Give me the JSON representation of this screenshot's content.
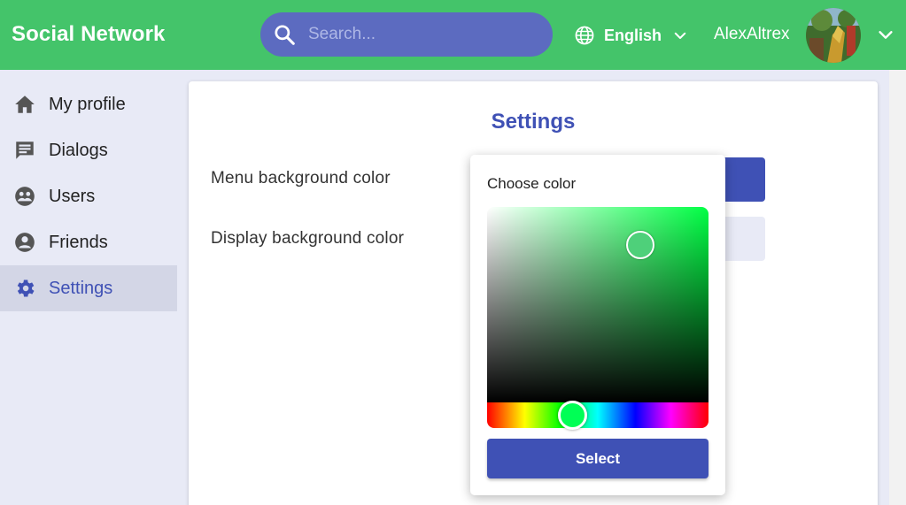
{
  "header": {
    "brand": "Social Network",
    "search": {
      "placeholder": "Search..."
    },
    "language": "English",
    "username": "AlexAltrex"
  },
  "sidebar": {
    "items": [
      {
        "label": "My profile",
        "icon": "home-icon"
      },
      {
        "label": "Dialogs",
        "icon": "chat-icon"
      },
      {
        "label": "Users",
        "icon": "users-icon"
      },
      {
        "label": "Friends",
        "icon": "friend-icon"
      },
      {
        "label": "Settings",
        "icon": "gear-icon",
        "active": true
      }
    ]
  },
  "settings": {
    "title": "Settings",
    "menu_bg_label": "Menu background color",
    "display_bg_label": "Display background color",
    "menu_bg_color": "#3f51b5",
    "display_bg_color": "#e8eaf6"
  },
  "color_picker": {
    "title": "Choose color",
    "select_label": "Select",
    "selected_color": "#4ed07a",
    "hue_color": "#00ff44"
  },
  "colors": {
    "header": "#44c46a",
    "accent": "#3f51b5",
    "search_bg": "#5c6bc0",
    "page_bg": "#e8eaf6"
  }
}
